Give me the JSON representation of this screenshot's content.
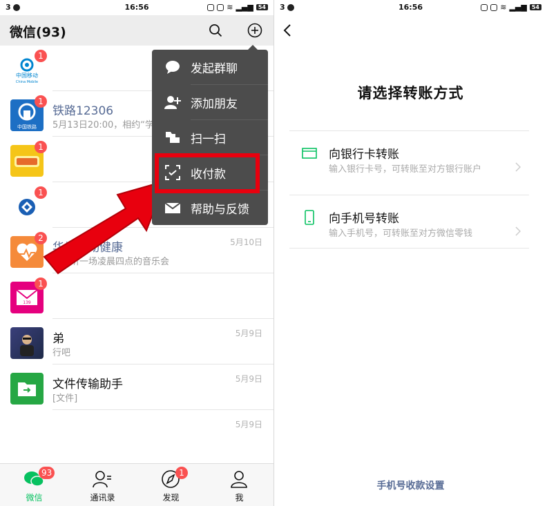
{
  "status_bar": {
    "left_num": "3",
    "time": "16:56",
    "battery": "54"
  },
  "left": {
    "header": {
      "title": "微信(93)"
    },
    "chats": [
      {
        "name": "",
        "message": "",
        "date": "",
        "badge": "1",
        "logo_text": "中国移动",
        "logo_sub": "China Mobile"
      },
      {
        "name": "铁路12306",
        "message": "5月13日20:00，相约“学",
        "date": "",
        "badge": "1",
        "logo_sub": "中国铁路"
      },
      {
        "name": "",
        "message": "",
        "date": "",
        "badge": "1"
      },
      {
        "name": "",
        "message": "",
        "date": "",
        "badge": "1"
      },
      {
        "name": "华为运动健康",
        "message": "，来听一场凌晨四点的音乐会",
        "date": "5月10日",
        "badge": "2"
      },
      {
        "name": "",
        "message": "",
        "date": "",
        "badge": "1",
        "logo_text": "139"
      },
      {
        "name": "弟",
        "message": "行吧",
        "date": "5月9日",
        "badge": ""
      },
      {
        "name": "文件传输助手",
        "message": "[文件]",
        "date": "5月9日",
        "badge": ""
      },
      {
        "name": "",
        "message": "",
        "date": "5月9日",
        "badge": ""
      }
    ],
    "popup": [
      {
        "label": "发起群聊",
        "icon": "chat-bubble-icon"
      },
      {
        "label": "添加朋友",
        "icon": "add-friend-icon"
      },
      {
        "label": "扫一扫",
        "icon": "scan-icon"
      },
      {
        "label": "收付款",
        "icon": "payment-icon"
      },
      {
        "label": "帮助与反馈",
        "icon": "mail-icon"
      }
    ],
    "tabs": [
      {
        "label": "微信",
        "badge": "93",
        "active": true
      },
      {
        "label": "通讯录",
        "badge": ""
      },
      {
        "label": "发现",
        "badge": "1"
      },
      {
        "label": "我",
        "badge": ""
      }
    ],
    "colors": {
      "accent_green": "#07c160",
      "highlight_red": "#e8000e",
      "badge_red": "#fa5151"
    }
  },
  "right": {
    "title": "请选择转账方式",
    "options": [
      {
        "title": "向银行卡转账",
        "desc": "输入银行卡号，可转账至对方银行账户",
        "icon": "bank-card-icon"
      },
      {
        "title": "向手机号转账",
        "desc": "输入手机号，可转账至对方微信零钱",
        "icon": "phone-icon"
      }
    ],
    "footer_link": "手机号收款设置"
  }
}
